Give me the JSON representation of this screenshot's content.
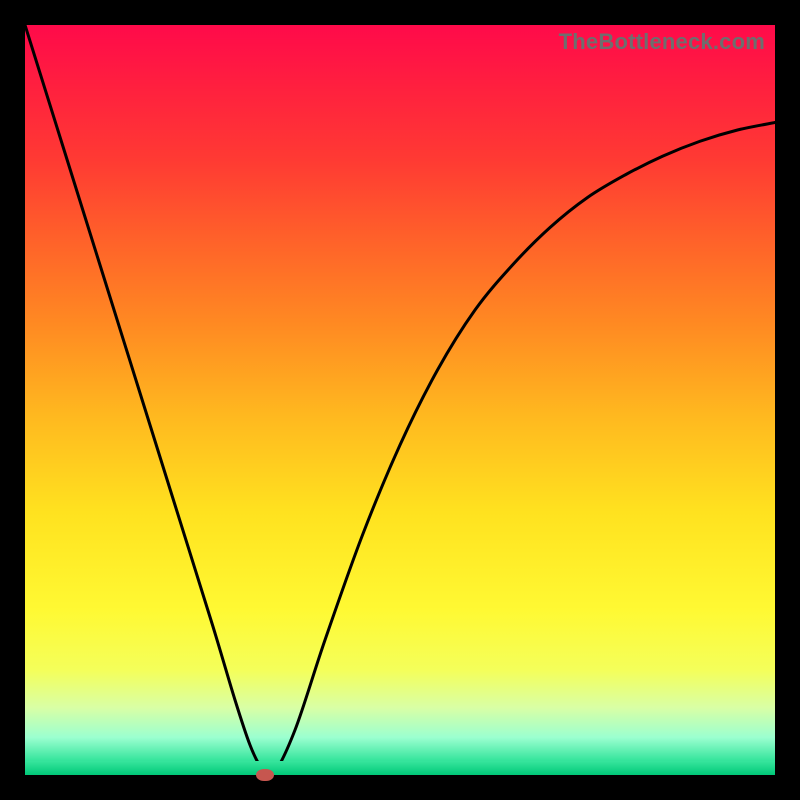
{
  "watermark": "TheBottleneck.com",
  "colors": {
    "frame": "#000000",
    "gradient_top": "#ff0a4a",
    "gradient_bottom": "#00c878",
    "curve": "#000000",
    "marker": "#c6564f"
  },
  "chart_data": {
    "type": "line",
    "title": "",
    "xlabel": "",
    "ylabel": "",
    "xlim": [
      0,
      100
    ],
    "ylim": [
      0,
      100
    ],
    "grid": false,
    "series": [
      {
        "name": "curve",
        "x": [
          0,
          5,
          10,
          15,
          20,
          25,
          28,
          30,
          31.5,
          33,
          36,
          40,
          45,
          50,
          55,
          60,
          65,
          70,
          75,
          80,
          85,
          90,
          95,
          100
        ],
        "y": [
          100,
          84,
          68,
          52,
          36,
          20,
          10,
          4,
          1,
          0,
          6,
          18,
          32,
          44,
          54,
          62,
          68,
          73,
          77,
          80,
          82.5,
          84.5,
          86,
          87
        ]
      }
    ],
    "marker": {
      "x": 32,
      "y": 0
    }
  }
}
